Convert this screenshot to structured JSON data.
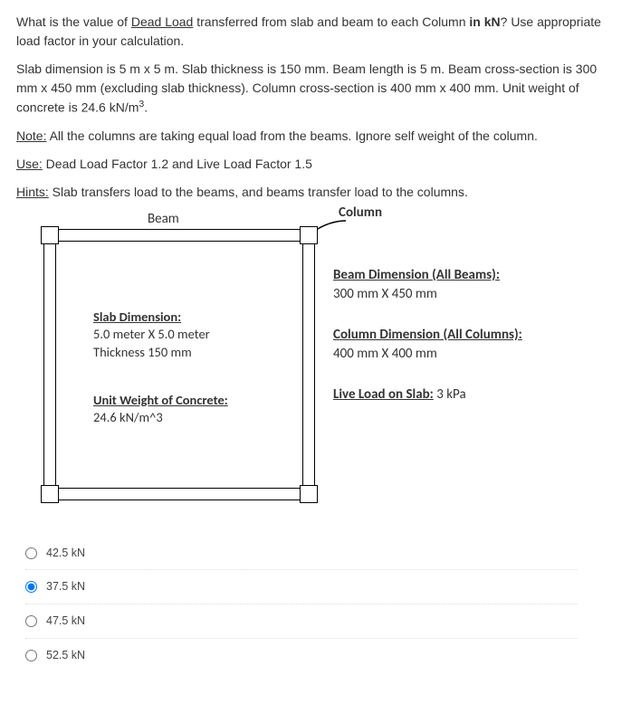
{
  "question": {
    "p1_a": "What is the value of ",
    "p1_u": "Dead Load",
    "p1_b": "  transferred from slab and beam to each Column ",
    "p1_c": "in kN",
    "p1_d": "? Use appropriate load factor in your calculation.",
    "p2": "Slab dimension is 5 m x 5 m. Slab thickness is 150 mm. Beam length is 5 m. Beam cross-section is 300 mm x 450 mm (excluding slab thickness). Column cross-section is 400 mm x 400 mm. Unit weight of concrete is 24.6 kN/m",
    "p2_sup": "3",
    "p2_end": ".",
    "p3_u": "Note:",
    "p3_t": " All the columns are taking equal load from the beams. Ignore self weight of the column.",
    "p4_u": "Use:",
    "p4_t": " Dead Load Factor 1.2 and Live Load Factor 1.5",
    "p5_u": "Hints:",
    "p5_t": " Slab transfers load to the beams, and beams transfer load to the columns."
  },
  "figure": {
    "beam_label": "Beam",
    "column_label": "Column",
    "slab_hd": "Slab Dimension:",
    "slab_l1": "5.0 meter X 5.0 meter",
    "slab_l2": "Thickness 150 mm",
    "uw_hd": "Unit Weight of Concrete:",
    "uw_v": "24.6 kN/m^3",
    "beam_dim_hd": "Beam Dimension (All Beams):",
    "beam_dim_v": "300 mm X 450 mm",
    "col_dim_hd": "Column Dimension (All Columns):",
    "col_dim_v": "400 mm X 400 mm",
    "live_hd": "Live Load on Slab:",
    "live_v": " 3 kPa"
  },
  "choices": [
    {
      "label": "42.5 kN",
      "selected": false
    },
    {
      "label": "37.5 kN",
      "selected": true
    },
    {
      "label": "47.5 kN",
      "selected": false
    },
    {
      "label": "52.5 kN",
      "selected": false
    }
  ]
}
